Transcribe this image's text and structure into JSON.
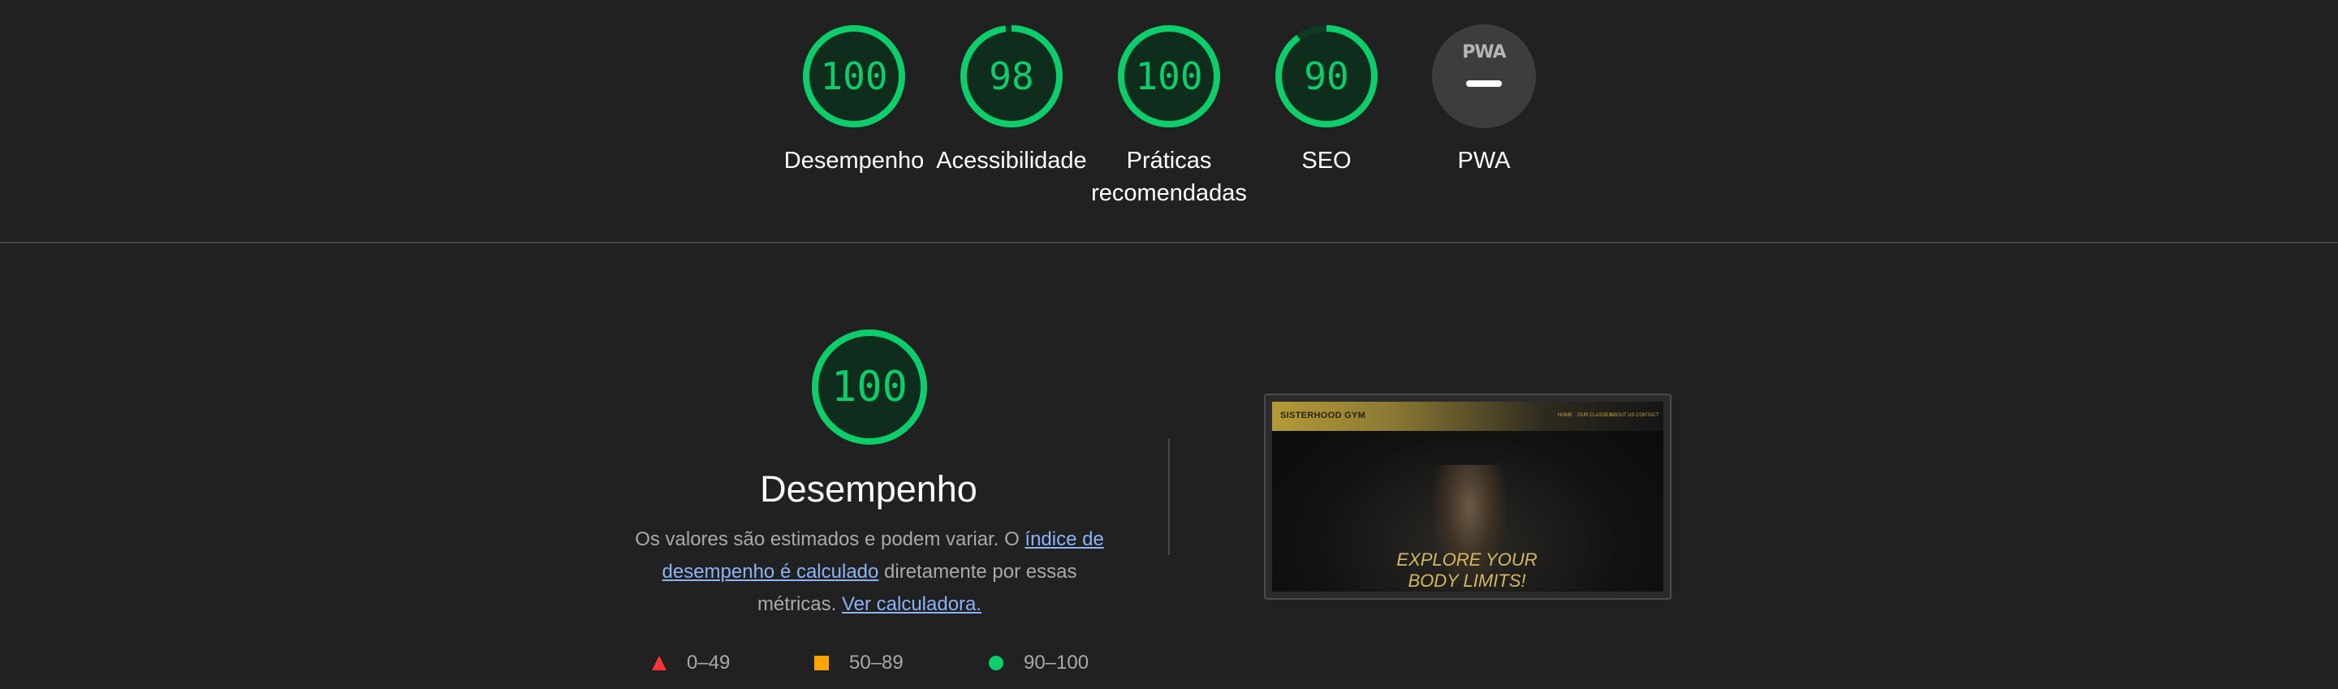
{
  "top_gauges": [
    {
      "score": "100",
      "label_line1": "Desempenho",
      "label_line2": "",
      "fraction": 1.0
    },
    {
      "score": "98",
      "label_line1": "Acessibilidade",
      "label_line2": "",
      "fraction": 0.98
    },
    {
      "score": "100",
      "label_line1": "Práticas",
      "label_line2": "recomendadas",
      "fraction": 1.0
    },
    {
      "score": "90",
      "label_line1": "SEO",
      "label_line2": "",
      "fraction": 0.9
    }
  ],
  "pwa": {
    "badge_text": "PWA",
    "label": "PWA"
  },
  "performance": {
    "score": "100",
    "fraction": 1.0,
    "title": "Desempenho",
    "desc_part1": "Os valores são estimados e podem variar. O ",
    "desc_link1": "índice de desempenho é calculado",
    "desc_part2": " diretamente por essas métricas. ",
    "desc_link2": "Ver calculadora."
  },
  "legend": [
    {
      "shape": "triangle",
      "color": "#ff3333",
      "label": "0–49"
    },
    {
      "shape": "square",
      "color": "#ffa400",
      "label": "50–89"
    },
    {
      "shape": "circle",
      "color": "#0cce6b",
      "label": "90–100"
    }
  ],
  "screenshot": {
    "logo": "SISTERHOOD GYM",
    "menu": [
      "HOME",
      "OUR CLASSES",
      "ABOUT US",
      "CONTACT"
    ],
    "headline_line1": "EXPLORE YOUR",
    "headline_line2": "BODY LIMITS!"
  },
  "colors": {
    "pass": "#0cce6b",
    "ring_bg": "#0f3a24",
    "background": "#212121",
    "link": "#8ab4f8"
  }
}
